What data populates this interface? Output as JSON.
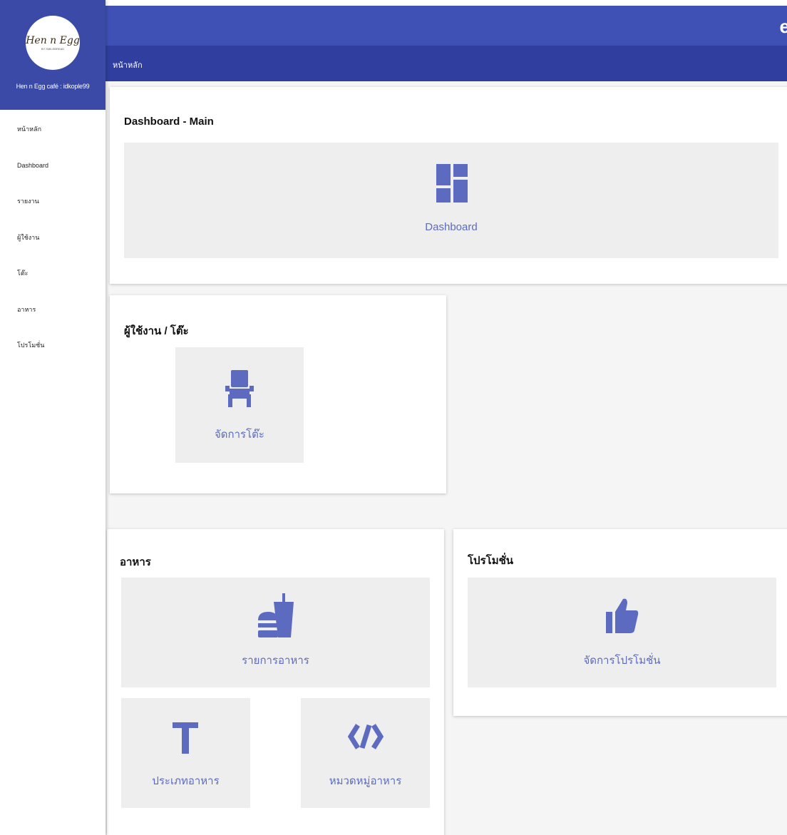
{
  "sidebar": {
    "logo_text": "Hen n Egg",
    "logo_subtext": "BY SMILEBREAD",
    "user_label": "Hen n Egg café : idkople99",
    "items": [
      {
        "label": "หน้าหลัก"
      },
      {
        "label": "Dashboard"
      },
      {
        "label": "รายงาน"
      },
      {
        "label": "ผู้ใช้งาน"
      },
      {
        "label": "โต๊ะ"
      },
      {
        "label": "อาหาร"
      },
      {
        "label": "โปรโมชั่น"
      }
    ]
  },
  "topbar": {
    "letter": "e"
  },
  "breadcrumb": {
    "label": "หน้าหลัก"
  },
  "cards": {
    "main": {
      "title": "Dashboard - Main",
      "tile": {
        "label": "Dashboard",
        "icon": "dashboard-icon"
      }
    },
    "users": {
      "title": "ผู้ใช้งาน / โต๊ะ",
      "tile": {
        "label": "จัดการโต๊ะ",
        "icon": "chair-icon"
      }
    },
    "food": {
      "title": "อาหาร",
      "tiles": [
        {
          "label": "รายการอาหาร",
          "icon": "fastfood-icon"
        },
        {
          "label": "ประเภทอาหาร",
          "icon": "text-t-icon"
        },
        {
          "label": "หมวดหมู่อาหาร",
          "icon": "code-icon"
        }
      ]
    },
    "promo": {
      "title": "โปรโมชั่น",
      "tile": {
        "label": "จัดการโปรโมชั่น",
        "icon": "thumb-up-icon"
      }
    }
  },
  "colors": {
    "sidebar_header": "#3a4aa6",
    "topbar": "#3f51b5",
    "subbar": "#303f9f",
    "accent": "#5c6bc0",
    "tile_bg": "#eeeeee"
  }
}
